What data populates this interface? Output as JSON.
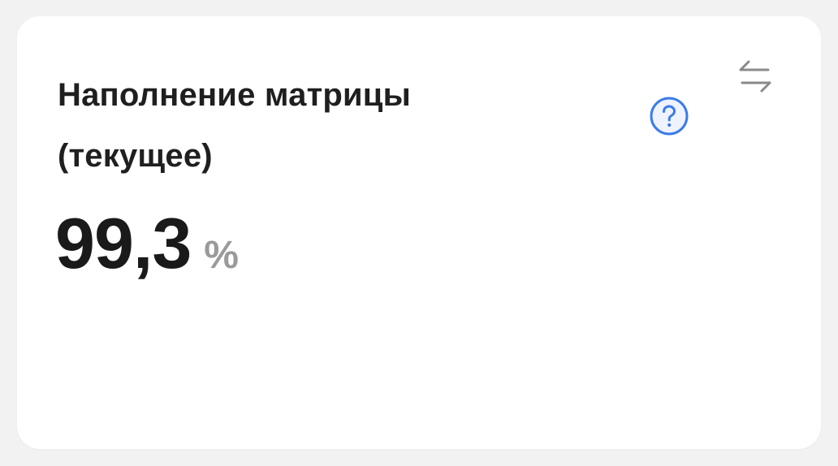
{
  "card": {
    "title": "Наполнение матрицы (текущее)",
    "value": "99,3",
    "unit": "%",
    "icons": {
      "help": "question-circle-icon",
      "swap": "swap-arrows-icon"
    },
    "colors": {
      "help_icon": "#3b7be8",
      "swap_icon": "#8a8a8a",
      "title": "#1f1f1f",
      "unit": "#9a9a9a"
    }
  }
}
